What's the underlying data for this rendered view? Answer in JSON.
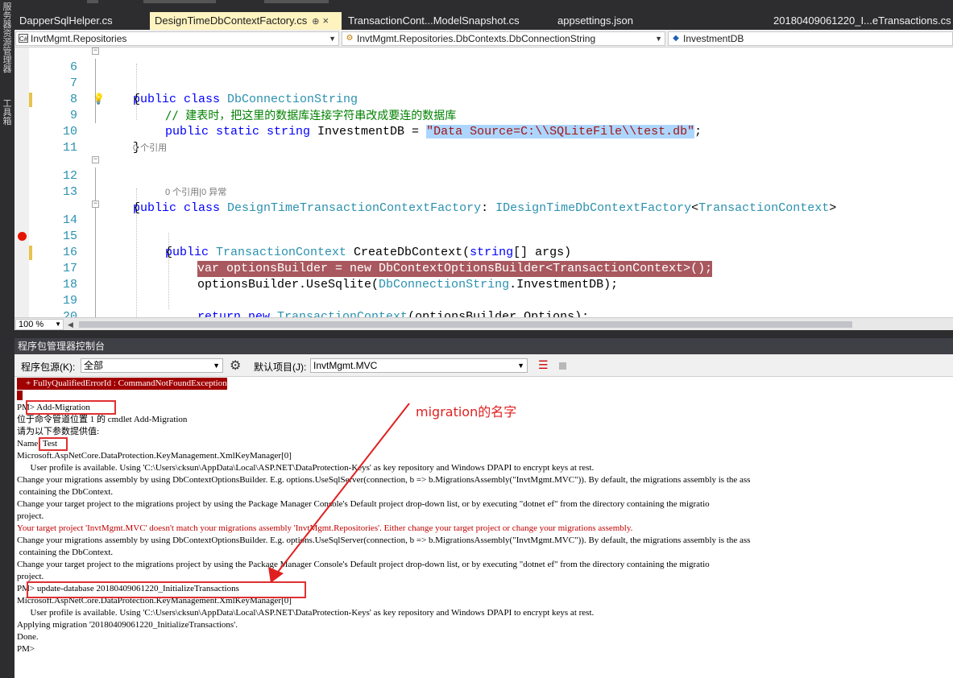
{
  "left_strip": {
    "label1": "服务器资源管理器",
    "label2": "工具箱"
  },
  "tabs": [
    {
      "label": "DapperSqlHelper.cs",
      "active": false
    },
    {
      "label": "DesignTimeDbContextFactory.cs",
      "active": true,
      "pin": "⊕",
      "close": "×"
    },
    {
      "label": "TransactionCont...ModelSnapshot.cs",
      "active": false
    },
    {
      "label": "appsettings.json",
      "active": false
    },
    {
      "label": "20180409061220_I...eTransactions.cs",
      "active": false
    }
  ],
  "navbar": {
    "project": "InvtMgmt.Repositories",
    "type": "InvtMgmt.Repositories.DbContexts.DbConnectionString",
    "member": "InvestmentDB"
  },
  "editor": {
    "lines": {
      "n6": "6",
      "n7": "7",
      "n8": "8",
      "n9": "9",
      "n10": "10",
      "n11": "11",
      "n12": "12",
      "n13": "13",
      "n14": "14",
      "n15": "15",
      "n16": "16",
      "n17": "17",
      "n18": "18",
      "n19": "19",
      "n20": "20"
    },
    "code": {
      "l6_kw": "public class ",
      "l6_ty": "DbConnectionString",
      "l7": "{",
      "l8_comment": "// 建表时，把这里的数据库连接字符串改成要连的数据库",
      "l9_kw": "public static string ",
      "l9_name": "InvestmentDB = ",
      "l9_str": "\"Data Source=C:\\\\SQLiteFile\\\\test.db\"",
      "l9_end": ";",
      "l10": "}",
      "lens12": "0 个引用",
      "l12_kw": "public class ",
      "l12_ty": "DesignTimeTransactionContextFactory",
      "l12_colon": ": ",
      "l12_iface": "IDesignTimeDbContextFactory",
      "l12_lt": "<",
      "l12_ctx": "TransactionContext",
      "l12_gt": ">",
      "l13": "{",
      "lens14": "0 个引用|0 异常",
      "l14_kw": "public ",
      "l14_ty": "TransactionContext",
      "l14_name": " CreateDbContext(",
      "l14_kw2": "string",
      "l14_end": "[] args)",
      "l15": "{",
      "l16": "var optionsBuilder = new DbContextOptionsBuilder<TransactionContext>();",
      "l17_a": "optionsBuilder.UseSqlite(",
      "l17_ty": "DbConnectionString",
      "l17_b": ".InvestmentDB);",
      "l19_kw": "return new ",
      "l19_ty": "TransactionContext",
      "l19_end": "(optionsBuilder.Options);",
      "l20": "}"
    }
  },
  "zoom": "100 %",
  "pmc": {
    "title": "程序包管理器控制台",
    "source_label": "程序包源(K):",
    "source_value": "全部",
    "default_project_label": "默认项目(J):",
    "default_project_value": "InvtMgmt.MVC"
  },
  "console_lines": [
    "    + FullyQualifiedErrorId : CommandNotFoundException",
    "",
    "PM> Add-Migration",
    "位于命令管道位置 1 的 cmdlet Add-Migration",
    "请为以下参数提供值:",
    "Name: Test",
    "Microsoft.AspNetCore.DataProtection.KeyManagement.XmlKeyManager[0]",
    "      User profile is available. Using 'C:\\Users\\cksun\\AppData\\Local\\ASP.NET\\DataProtection-Keys' as key repository and Windows DPAPI to encrypt keys at rest.",
    "Change your migrations assembly by using DbContextOptionsBuilder. E.g. options.UseSqlServer(connection, b => b.MigrationsAssembly(\"InvtMgmt.MVC\")). By default, the migrations assembly is the ass",
    " containing the DbContext.",
    "Change your target project to the migrations project by using the Package Manager Console's Default project drop-down list, or by executing \"dotnet ef\" from the directory containing the migratio",
    "project.",
    "Your target project 'InvtMgmt.MVC' doesn't match your migrations assembly 'InvtMgmt.Repositories'. Either change your target project or change your migrations assembly.",
    "Change your migrations assembly by using DbContextOptionsBuilder. E.g. options.UseSqlServer(connection, b => b.MigrationsAssembly(\"InvtMgmt.MVC\")). By default, the migrations assembly is the ass",
    " containing the DbContext.",
    "Change your target project to the migrations project by using the Package Manager Console's Default project drop-down list, or by executing \"dotnet ef\" from the directory containing the migratio",
    "project.",
    "PM> update-database 20180409061220_InitializeTransactions",
    "Microsoft.AspNetCore.DataProtection.KeyManagement.XmlKeyManager[0]",
    "      User profile is available. Using 'C:\\Users\\cksun\\AppData\\Local\\ASP.NET\\DataProtection-Keys' as key repository and Windows DPAPI to encrypt keys at rest.",
    "Applying migration '20180409061220_InitializeTransactions'.",
    "Done.",
    "PM>"
  ],
  "annotation": "migration的名字",
  "colors": {
    "keyword": "#0000ff",
    "type": "#2b91af",
    "comment": "#008000",
    "string": "#a31515",
    "breakpoint": "#e51400",
    "annotation": "#e02020"
  }
}
